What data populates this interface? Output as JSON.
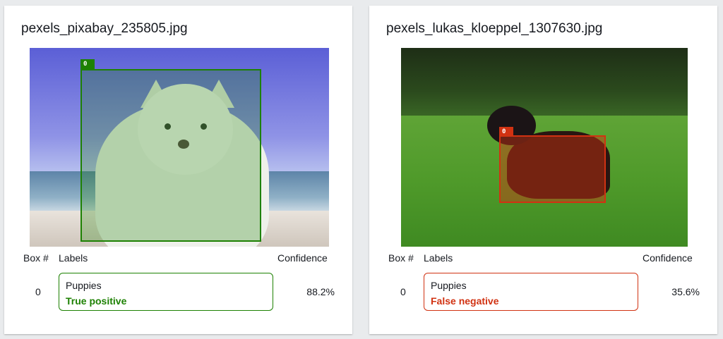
{
  "colors": {
    "true_positive": "#1d8102",
    "false_negative": "#d13212"
  },
  "columns": {
    "box": "Box #",
    "labels": "Labels",
    "confidence": "Confidence"
  },
  "cards": [
    {
      "filename": "pexels_pixabay_235805.jpg",
      "box_tag": "0",
      "row": {
        "index": "0",
        "label": "Puppies",
        "status": "True positive",
        "confidence": "88.2%"
      }
    },
    {
      "filename": "pexels_lukas_kloeppel_1307630.jpg",
      "box_tag": "0",
      "row": {
        "index": "0",
        "label": "Puppies",
        "status": "False negative",
        "confidence": "35.6%"
      }
    }
  ]
}
